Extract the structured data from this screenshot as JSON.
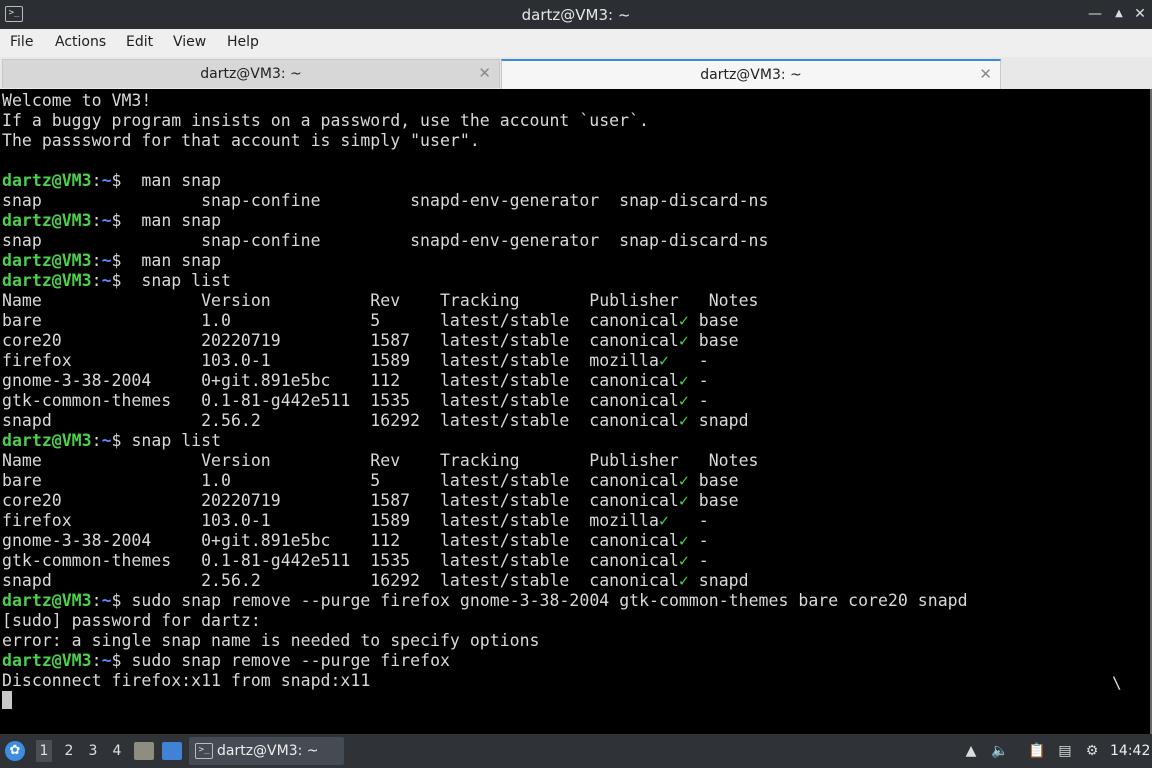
{
  "window": {
    "title": "dartz@VM3: ~",
    "app_icon": "terminal-icon",
    "controls": [
      "minimize-icon",
      "restore-icon",
      "close-icon"
    ]
  },
  "menu": [
    "File",
    "Actions",
    "Edit",
    "View",
    "Help"
  ],
  "tabs": [
    {
      "label": "dartz@VM3: ~",
      "active": false
    },
    {
      "label": "dartz@VM3: ~",
      "active": true
    }
  ],
  "terminal": {
    "prompt": {
      "user": "dartz@VM3",
      "colon": ":",
      "path": "~",
      "symbol": "$"
    },
    "lines": [
      {
        "type": "text",
        "text": "Welcome to VM3!"
      },
      {
        "type": "text",
        "text": "If a buggy program insists on a password, use the account `user`."
      },
      {
        "type": "text",
        "text": "The passsword for that account is simply \"user\"."
      },
      {
        "type": "text",
        "text": ""
      },
      {
        "type": "prompt",
        "cmd": "  man snap"
      },
      {
        "type": "text",
        "text": "snap                snap-confine         snapd-env-generator  snap-discard-ns"
      },
      {
        "type": "prompt",
        "cmd": "  man snap"
      },
      {
        "type": "text",
        "text": "snap                snap-confine         snapd-env-generator  snap-discard-ns"
      },
      {
        "type": "prompt",
        "cmd": "  man snap"
      },
      {
        "type": "prompt",
        "cmd": "  snap list"
      },
      {
        "type": "text",
        "text": "Name                Version          Rev    Tracking       Publisher   Notes"
      },
      {
        "type": "snap",
        "pre": "bare                1.0              5      latest/stable  canonical",
        "post": " base"
      },
      {
        "type": "snap",
        "pre": "core20              20220719         1587   latest/stable  canonical",
        "post": " base"
      },
      {
        "type": "snap",
        "pre": "firefox             103.0-1          1589   latest/stable  mozilla",
        "post": "   -"
      },
      {
        "type": "snap",
        "pre": "gnome-3-38-2004     0+git.891e5bc    112    latest/stable  canonical",
        "post": " -"
      },
      {
        "type": "snap",
        "pre": "gtk-common-themes   0.1-81-g442e511  1535   latest/stable  canonical",
        "post": " -"
      },
      {
        "type": "snap",
        "pre": "snapd               2.56.2           16292  latest/stable  canonical",
        "post": " snapd"
      },
      {
        "type": "prompt",
        "cmd": " snap list"
      },
      {
        "type": "text",
        "text": "Name                Version          Rev    Tracking       Publisher   Notes"
      },
      {
        "type": "snap",
        "pre": "bare                1.0              5      latest/stable  canonical",
        "post": " base"
      },
      {
        "type": "snap",
        "pre": "core20              20220719         1587   latest/stable  canonical",
        "post": " base"
      },
      {
        "type": "snap",
        "pre": "firefox             103.0-1          1589   latest/stable  mozilla",
        "post": "   -"
      },
      {
        "type": "snap",
        "pre": "gnome-3-38-2004     0+git.891e5bc    112    latest/stable  canonical",
        "post": " -"
      },
      {
        "type": "snap",
        "pre": "gtk-common-themes   0.1-81-g442e511  1535   latest/stable  canonical",
        "post": " -"
      },
      {
        "type": "snap",
        "pre": "snapd               2.56.2           16292  latest/stable  canonical",
        "post": " snapd"
      },
      {
        "type": "prompt",
        "cmd": " sudo snap remove --purge firefox gnome-3-38-2004 gtk-common-themes bare core20 snapd"
      },
      {
        "type": "text",
        "text": "[sudo] password for dartz:"
      },
      {
        "type": "text",
        "text": "error: a single snap name is needed to specify options"
      },
      {
        "type": "prompt",
        "cmd": " sudo snap remove --purge firefox"
      },
      {
        "type": "text",
        "text": "Disconnect firefox:x11 from snapd:x11"
      }
    ],
    "check_mark": "✓",
    "spinner": "\\"
  },
  "taskbar": {
    "start_icon": "lubuntu-start-icon",
    "workspaces": [
      "1",
      "2",
      "3",
      "4"
    ],
    "active_workspace": "1",
    "task_label": "dartz@VM3: ~",
    "tray_icons": [
      "upload-icon",
      "volume-icon",
      "clipboard-icon",
      "network-icon",
      "update-icon"
    ],
    "clock": "14:42"
  }
}
